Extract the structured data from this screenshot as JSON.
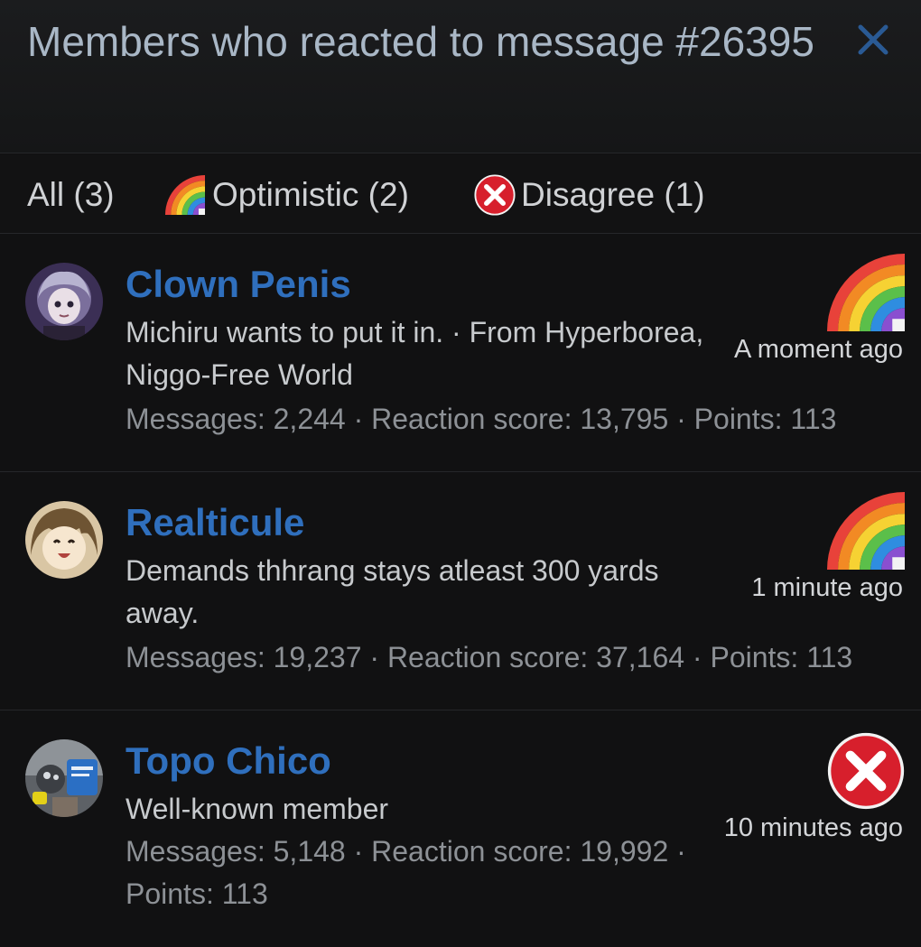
{
  "dialog": {
    "title": "Members who reacted to message #26395",
    "close_icon": "close-icon"
  },
  "tabs": [
    {
      "label": "All (3)",
      "icon": ""
    },
    {
      "label": "Optimistic (2)",
      "icon": "rainbow-icon"
    },
    {
      "label": "Disagree (1)",
      "icon": "red-x-icon"
    }
  ],
  "members": [
    {
      "name": "Clown Penis",
      "title": "Michiru wants to put it in. · From Hyperborea, Niggo-Free World",
      "stats": "Messages: 2,244 · Reaction score: 13,795 · Points: 113",
      "reaction_icon": "rainbow-icon",
      "time": "A moment ago"
    },
    {
      "name": "Realticule",
      "title": "Demands thhrang stays atleast 300 yards away.",
      "stats": "Messages: 19,237 · Reaction score: 37,164 · Points: 113",
      "reaction_icon": "rainbow-icon",
      "time": "1 minute ago"
    },
    {
      "name": "Topo Chico",
      "title": "Well-known member",
      "stats": "Messages: 5,148 · Reaction score: 19,992 · Points: 113",
      "reaction_icon": "red-x-icon",
      "time": "10 minutes ago"
    }
  ],
  "colors": {
    "username": "#2f6fbd",
    "title_text": "#a9b7c6",
    "close_icon": "#2a5a94",
    "background": "#111112"
  }
}
